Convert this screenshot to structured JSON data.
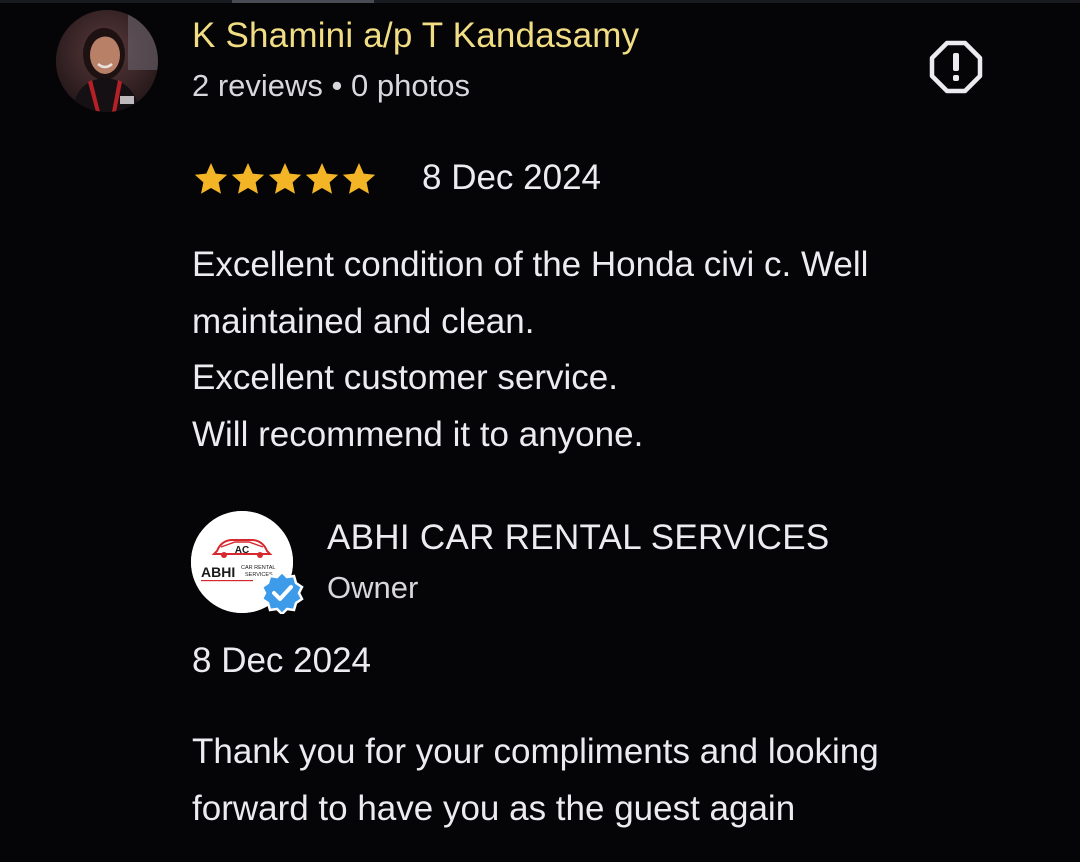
{
  "review": {
    "reviewer_name": "K Shamini a/p T Kandasamy",
    "reviewer_meta": "2 reviews • 0 photos",
    "rating": 5,
    "rating_max": 5,
    "date": "8 Dec 2024",
    "body_lines": [
      "Excellent condition of the Honda civi c. Well",
      "maintained and clean.",
      "Excellent customer service.",
      "Will recommend it to anyone."
    ],
    "icons": {
      "avatar": "reviewer-avatar",
      "report": "report-icon",
      "star": "star-icon"
    },
    "colors": {
      "name": "#f1de84",
      "star": "#f3b425"
    }
  },
  "owner_reply": {
    "owner_name": "ABHI CAR RENTAL SERVICES",
    "role": "Owner",
    "date": "8 Dec 2024",
    "body_lines": [
      "Thank you for your compliments and looking",
      "forward to have you as the guest again"
    ],
    "logo": {
      "brand": "ABHI",
      "monogram": "AC",
      "tagline": "CAR RENTAL SERVICES"
    },
    "icons": {
      "verified": "verified-badge-icon"
    },
    "colors": {
      "verified": "#3d9be9",
      "logo_red": "#d7282f"
    }
  }
}
